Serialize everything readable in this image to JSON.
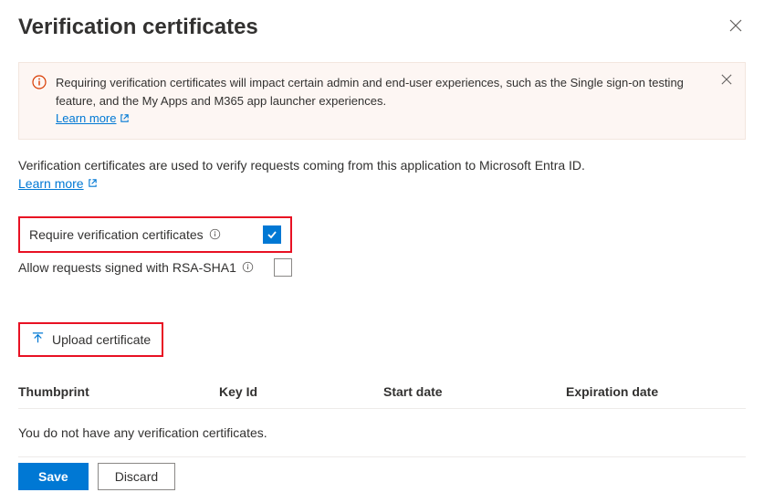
{
  "header": {
    "title": "Verification certificates"
  },
  "banner": {
    "text": "Requiring verification certificates will impact certain admin and end-user experiences, such as the Single sign-on testing feature, and the My Apps and M365 app launcher experiences.",
    "learn_more": "Learn more"
  },
  "description": {
    "text": "Verification certificates are used to verify requests coming from this application to Microsoft Entra ID.",
    "learn_more": "Learn more"
  },
  "options": {
    "require_label": "Require verification certificates",
    "require_checked": true,
    "allow_rsa_label": "Allow requests signed with RSA-SHA1",
    "allow_rsa_checked": false
  },
  "upload": {
    "label": "Upload certificate"
  },
  "table": {
    "columns": {
      "thumbprint": "Thumbprint",
      "key_id": "Key Id",
      "start_date": "Start date",
      "expiration_date": "Expiration date"
    },
    "empty_message": "You do not have any verification certificates."
  },
  "footer": {
    "save": "Save",
    "discard": "Discard"
  }
}
